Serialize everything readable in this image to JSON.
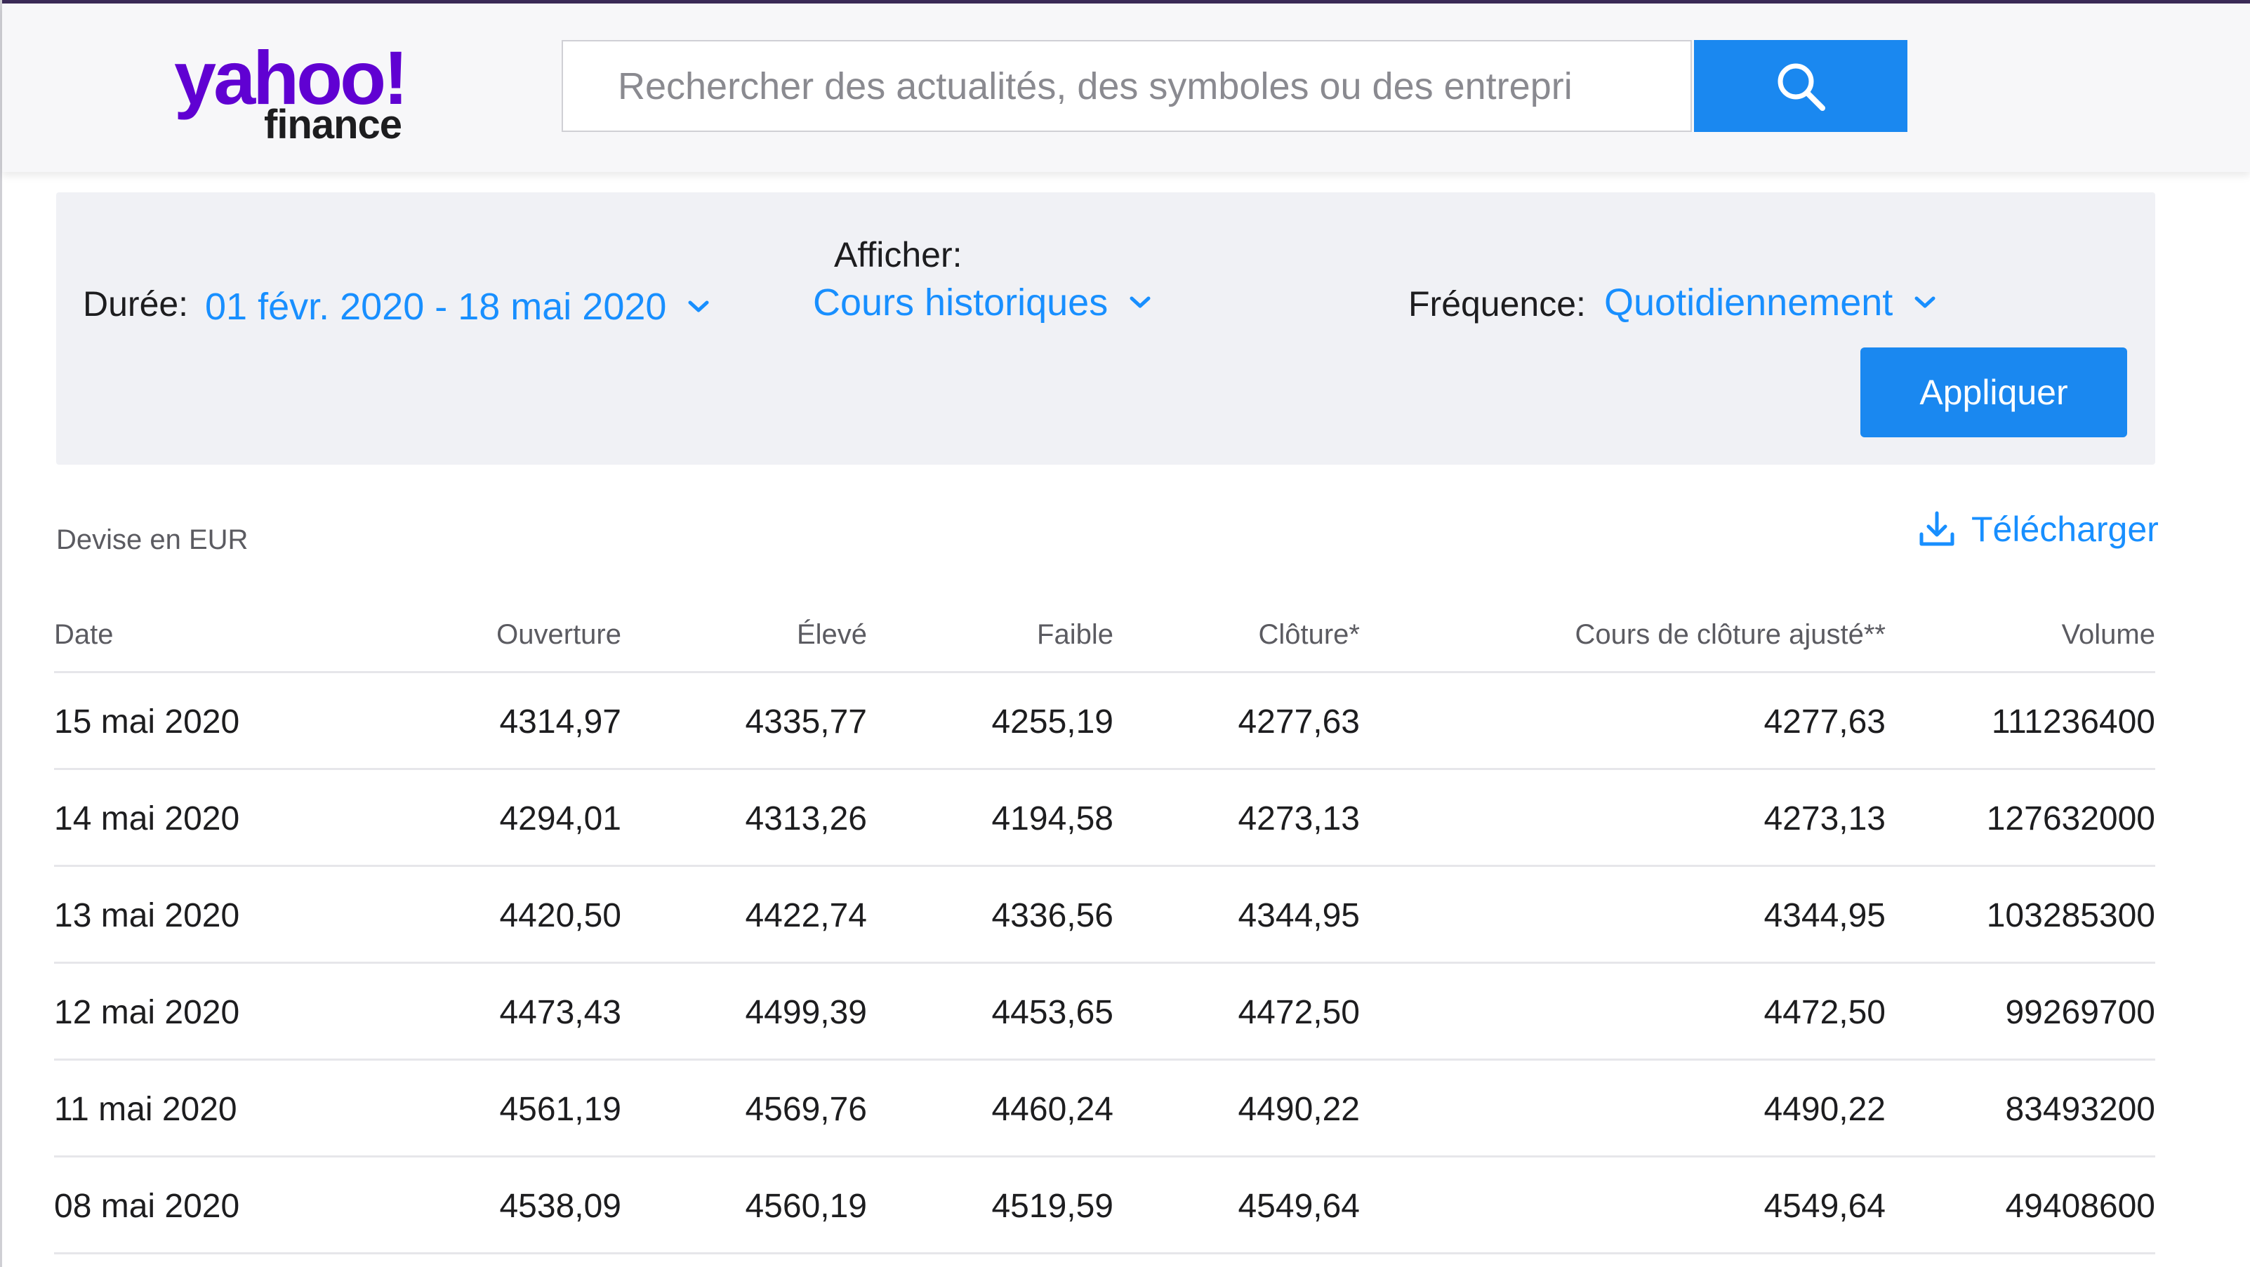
{
  "header": {
    "logo_yahoo": "yahoo!",
    "logo_finance": "finance",
    "search_placeholder": "Rechercher des actualités, des symboles ou des entrepri",
    "search_icon": "search-icon"
  },
  "filters": {
    "duration_label": "Durée:",
    "duration_value": "01 févr. 2020 - 18 mai 2020",
    "show_label": "Afficher:",
    "show_value": "Cours historiques",
    "frequency_label": "Fréquence:",
    "frequency_value": "Quotidiennement",
    "apply_label": "Appliquer"
  },
  "currency_note": "Devise en EUR",
  "download_label": "Télécharger",
  "colors": {
    "brand": "#6001d2",
    "accent": "#1a88f0",
    "link": "#188fff"
  },
  "table": {
    "columns": [
      "Date",
      "Ouverture",
      "Élevé",
      "Faible",
      "Clôture*",
      "Cours de clôture ajusté**",
      "Volume"
    ],
    "rows": [
      [
        "15 mai 2020",
        "4314,97",
        "4335,77",
        "4255,19",
        "4277,63",
        "4277,63",
        "111236400"
      ],
      [
        "14 mai 2020",
        "4294,01",
        "4313,26",
        "4194,58",
        "4273,13",
        "4273,13",
        "127632000"
      ],
      [
        "13 mai 2020",
        "4420,50",
        "4422,74",
        "4336,56",
        "4344,95",
        "4344,95",
        "103285300"
      ],
      [
        "12 mai 2020",
        "4473,43",
        "4499,39",
        "4453,65",
        "4472,50",
        "4472,50",
        "99269700"
      ],
      [
        "11 mai 2020",
        "4561,19",
        "4569,76",
        "4460,24",
        "4490,22",
        "4490,22",
        "83493200"
      ],
      [
        "08 mai 2020",
        "4538,09",
        "4560,19",
        "4519,59",
        "4549,64",
        "4549,64",
        "49408600"
      ]
    ]
  }
}
